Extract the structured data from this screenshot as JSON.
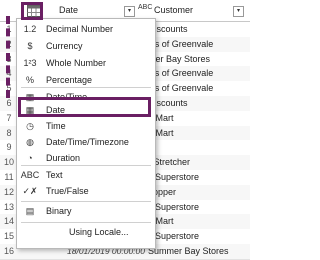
{
  "header": {
    "date_col": "Date",
    "customer_col": "Customer",
    "abc_icon": "ABC",
    "dropdown_glyph": "▾"
  },
  "rows": [
    {
      "n": "1",
      "date": "",
      "cust": "Discounts"
    },
    {
      "n": "2",
      "date": "",
      "cust": "n's of Greenvale"
    },
    {
      "n": "3",
      "date": "",
      "cust": "mer Bay Stores"
    },
    {
      "n": "4",
      "date": "",
      "cust": "n's of Greenvale"
    },
    {
      "n": "5",
      "date": "",
      "cust": "n's of Greenvale"
    },
    {
      "n": "6",
      "date": "",
      "cust": "Discounts"
    },
    {
      "n": "7",
      "date": "",
      "cust": "a Mart"
    },
    {
      "n": "8",
      "date": "",
      "cust": "a Mart"
    },
    {
      "n": "9",
      "date": "",
      "cust": "s"
    },
    {
      "n": "10",
      "date": "",
      "cust": "r Stretcher"
    },
    {
      "n": "11",
      "date": "",
      "cust": "s Superstore"
    },
    {
      "n": "12",
      "date": "",
      "cust": "hopper"
    },
    {
      "n": "13",
      "date": "",
      "cust": "s Superstore"
    },
    {
      "n": "14",
      "date": "",
      "cust": "a Mart"
    },
    {
      "n": "15",
      "date": "",
      "cust": "s Superstore"
    },
    {
      "n": "16",
      "date": "18/01/2019 00:00:00",
      "cust": "Summer Bay Stores"
    }
  ],
  "menu": [
    {
      "icon": "1.2",
      "label": "Decimal Number"
    },
    {
      "icon": "$",
      "label": "Currency"
    },
    {
      "icon": "1²3",
      "label": "Whole Number"
    },
    {
      "icon": "%",
      "label": "Percentage"
    },
    {
      "icon": "▦",
      "label": "Date/Time"
    },
    {
      "icon": "▦",
      "label": "Date"
    },
    {
      "icon": "◷",
      "label": "Time"
    },
    {
      "icon": "◍",
      "label": "Date/Time/Timezone"
    },
    {
      "icon": "◔",
      "label": "Duration"
    },
    {
      "icon": "ABC",
      "label": "Text"
    },
    {
      "icon": "✓✗",
      "label": "True/False"
    },
    {
      "icon": "▤",
      "label": "Binary"
    },
    {
      "icon": "",
      "label": "Using Locale..."
    }
  ]
}
